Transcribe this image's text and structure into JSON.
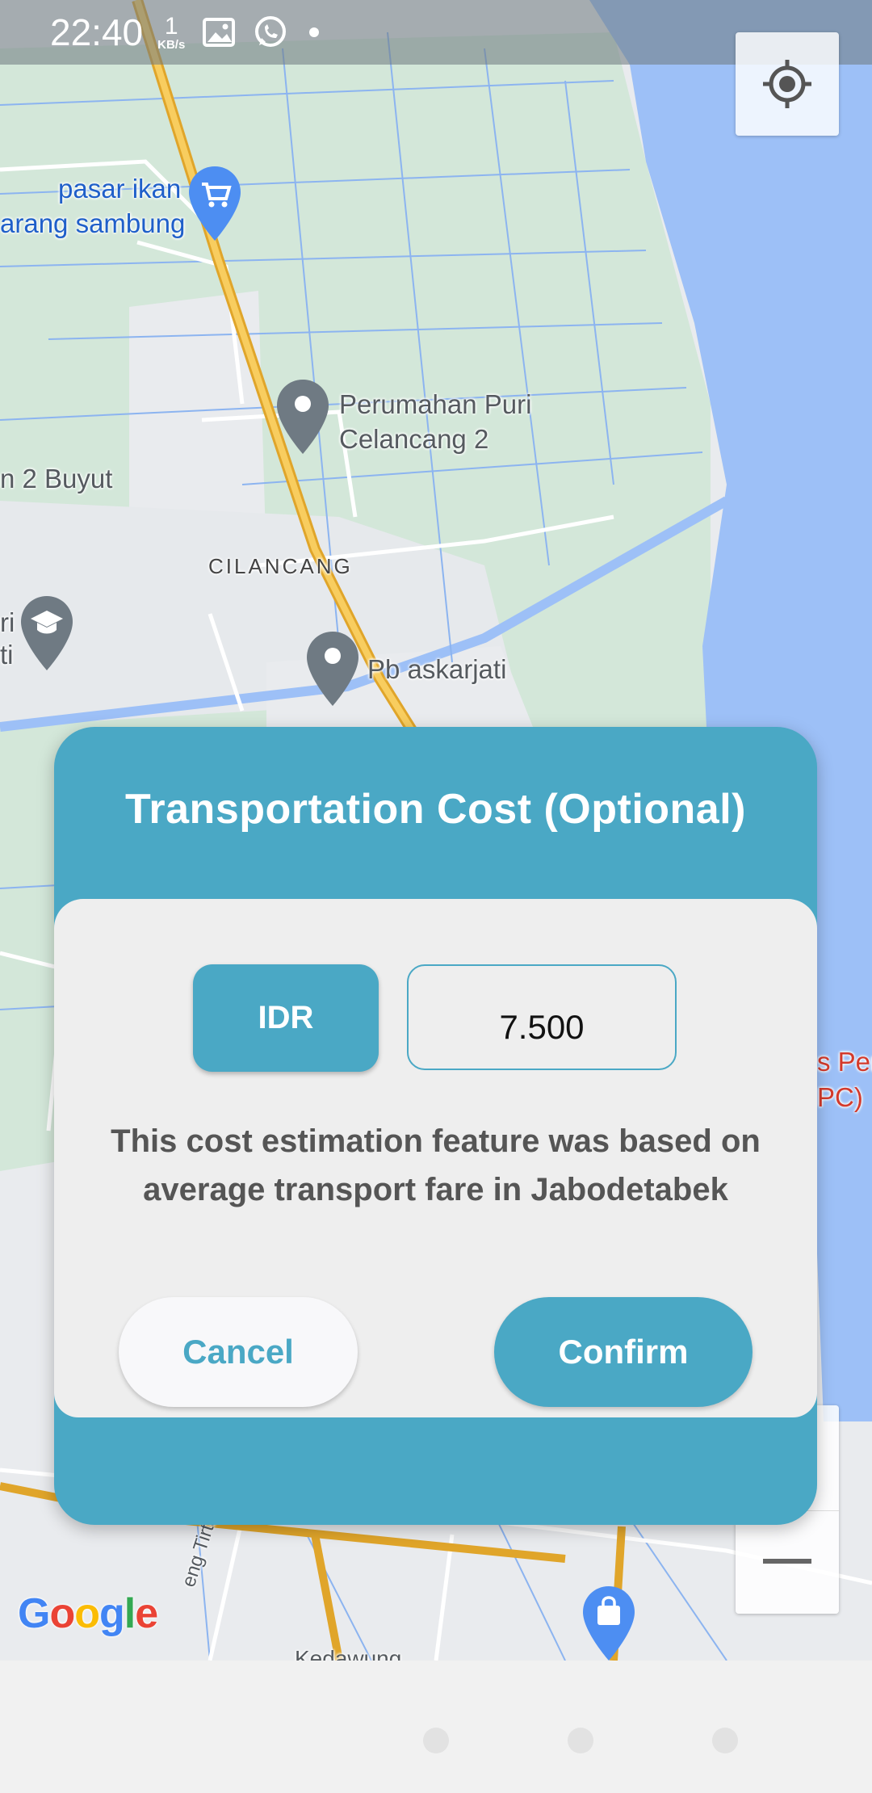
{
  "status_bar": {
    "time": "22:40",
    "speed_value": "1",
    "speed_unit": "KB/s",
    "icons": [
      "image-icon",
      "whatsapp-icon",
      "notification-dot-icon"
    ]
  },
  "map": {
    "labels": {
      "pasar_line1": "pasar ikan",
      "pasar_line2": "arang sambung",
      "perumahan_line1": "Perumahan Puri",
      "perumahan_line2": "Celancang 2",
      "buyut": "n 2 Buyut",
      "cilancang": "CILANCANG",
      "left_cut1": "ri",
      "left_cut2": "ti",
      "pb": "Pb askarjati",
      "pert_line1": "s Pert",
      "pert_line2": "PC)",
      "tirtayasa": "eng Tirtayasa",
      "kedawung": "Kedawung"
    },
    "google_logo": [
      "G",
      "o",
      "o",
      "g",
      "l",
      "e"
    ],
    "colors": {
      "water": "#9dc0f7",
      "green": "#d3e7d9",
      "road_major": "#f2b83f",
      "pin_grey": "#6f7a83",
      "pin_blue": "#4d8ef2"
    }
  },
  "controls": {
    "locate_icon": "my-location-icon",
    "zoom_out_icon": "minus-icon"
  },
  "dialog": {
    "title": "Transportation Cost (Optional)",
    "currency": "IDR",
    "amount": "7.500",
    "note": "This cost estimation feature was based on average transport fare in Jabodetabek",
    "cancel_label": "Cancel",
    "confirm_label": "Confirm",
    "accent_color": "#4aa8c5"
  }
}
